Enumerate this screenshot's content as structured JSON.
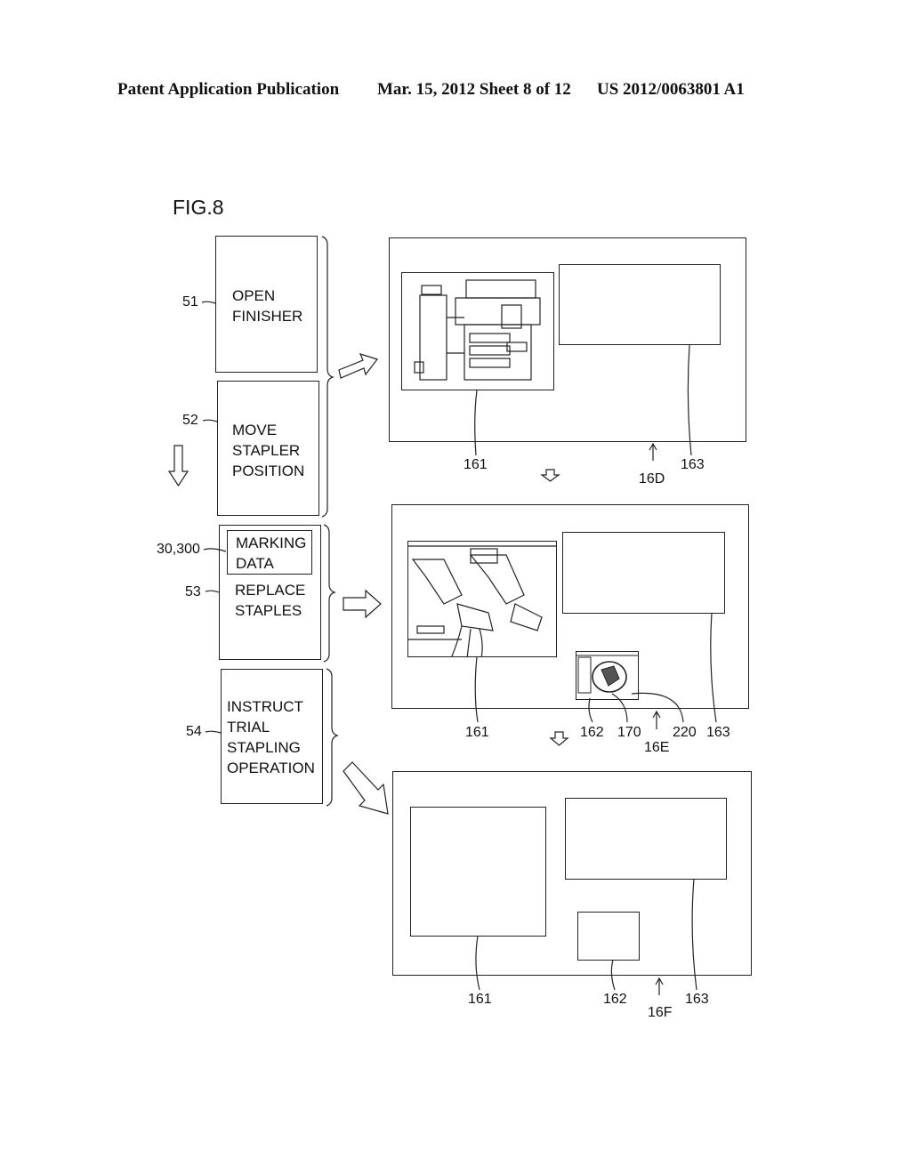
{
  "header": {
    "publication": "Patent Application Publication",
    "date_sheet": "Mar. 15, 2012  Sheet 8 of 12",
    "patent_number": "US 2012/0063801 A1"
  },
  "figure": {
    "title": "FIG.8",
    "steps": [
      {
        "ref": "51",
        "text": "OPEN\nFINISHER"
      },
      {
        "ref": "52",
        "text": "MOVE\nSTAPLER\nPOSITION"
      },
      {
        "ref": "53",
        "text": "REPLACE\nSTAPLES",
        "inner": {
          "ref": "30,300",
          "text": "MARKING\nDATA"
        }
      },
      {
        "ref": "54",
        "text": "INSTRUCT\nTRIAL\nSTAPLING\nOPERATION"
      }
    ],
    "screens": [
      {
        "id": "16D",
        "labels": [
          "161",
          "163"
        ],
        "image_161": "copier-machine-illustration"
      },
      {
        "id": "16E",
        "labels": [
          "161",
          "162",
          "170",
          "220",
          "163"
        ],
        "image_161": "stapler-unit-illustration",
        "image_162": "staple-cartridge-closeup"
      },
      {
        "id": "16F",
        "labels": [
          "161",
          "162",
          "163"
        ]
      }
    ]
  }
}
